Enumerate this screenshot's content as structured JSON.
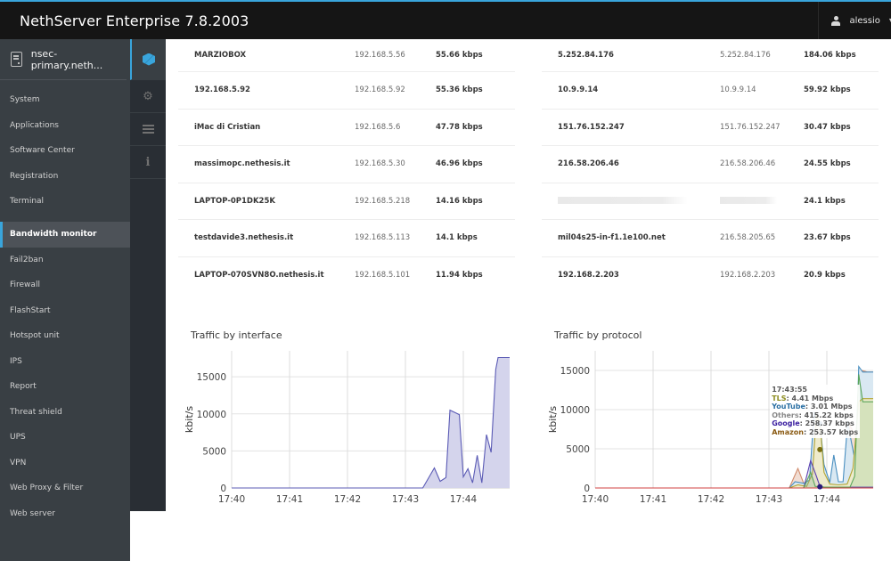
{
  "app": {
    "title": "NethServer Enterprise 7.8.2003",
    "user": "alessio"
  },
  "sidebar": {
    "host": "nsec-primary.neth...",
    "items": [
      {
        "label": "System"
      },
      {
        "label": "Applications"
      },
      {
        "label": "Software Center"
      },
      {
        "label": "Registration"
      },
      {
        "label": "Terminal"
      },
      {
        "label": "Bandwidth monitor",
        "active": true
      },
      {
        "label": "Fail2ban"
      },
      {
        "label": "Firewall"
      },
      {
        "label": "FlashStart"
      },
      {
        "label": "Hotspot unit"
      },
      {
        "label": "IPS"
      },
      {
        "label": "Report"
      },
      {
        "label": "Threat shield"
      },
      {
        "label": "UPS"
      },
      {
        "label": "VPN"
      },
      {
        "label": "Web Proxy & Filter"
      },
      {
        "label": "Web server"
      }
    ]
  },
  "iconbar": {
    "items": [
      {
        "icon": "cube-icon",
        "active": true
      },
      {
        "icon": "gear-icon"
      },
      {
        "icon": "list-icon"
      },
      {
        "icon": "info-icon"
      }
    ]
  },
  "tables": {
    "left": [
      {
        "name": "MARZIOBOX",
        "ip": "192.168.5.56",
        "rate": "55.66 kbps"
      },
      {
        "name": "192.168.5.92",
        "ip": "192.168.5.92",
        "rate": "55.36 kbps"
      },
      {
        "name": "iMac di Cristian",
        "ip": "192.168.5.6",
        "rate": "47.78 kbps"
      },
      {
        "name": "massimopc.nethesis.it",
        "ip": "192.168.5.30",
        "rate": "46.96 kbps"
      },
      {
        "name": "LAPTOP-0P1DK25K",
        "ip": "192.168.5.218",
        "rate": "14.16 kbps"
      },
      {
        "name": "testdavide3.nethesis.it",
        "ip": "192.168.5.113",
        "rate": "14.1 kbps"
      },
      {
        "name": "LAPTOP-070SVN8O.nethesis.it",
        "ip": "192.168.5.101",
        "rate": "11.94 kbps"
      }
    ],
    "right": [
      {
        "name": "5.252.84.176",
        "ip": "5.252.84.176",
        "rate": "184.06 kbps"
      },
      {
        "name": "10.9.9.14",
        "ip": "10.9.9.14",
        "rate": "59.92 kbps"
      },
      {
        "name": "151.76.152.247",
        "ip": "151.76.152.247",
        "rate": "30.47 kbps"
      },
      {
        "name": "216.58.206.46",
        "ip": "216.58.206.46",
        "rate": "24.55 kbps"
      },
      {
        "name": "",
        "ip": "",
        "rate": "24.1 kbps",
        "redacted": true
      },
      {
        "name": "mil04s25-in-f1.1e100.net",
        "ip": "216.58.205.65",
        "rate": "23.67 kbps"
      },
      {
        "name": "192.168.2.203",
        "ip": "192.168.2.203",
        "rate": "20.9 kbps"
      }
    ]
  },
  "tooltip": {
    "time": "17:43:55",
    "entries": [
      {
        "label": "TLS",
        "value": "4.41 Mbps",
        "color": "#8c8c1e"
      },
      {
        "label": "YouTube",
        "value": "3.01 Mbps",
        "color": "#2a6fa3"
      },
      {
        "label": "Others",
        "value": "415.22 kbps",
        "color": "#888888"
      },
      {
        "label": "Google",
        "value": "258.37 kbps",
        "color": "#3b1fa0"
      },
      {
        "label": "Amazon",
        "value": "253.57 kbps",
        "color": "#8a5a12"
      }
    ]
  },
  "chart_data": [
    {
      "type": "area",
      "title": "Traffic by interface",
      "xlabel": "",
      "ylabel": "kbit/s",
      "x_ticks": [
        "17:40",
        "17:41",
        "17:42",
        "17:43",
        "17:44"
      ],
      "xlim_minutes": [
        0,
        4.8
      ],
      "ylim": [
        0,
        18500
      ],
      "y_ticks": [
        0,
        5000,
        10000,
        15000
      ],
      "grid": true,
      "color": "#5b5bb5",
      "fill": "#d4d4ec",
      "series": [
        {
          "name": "interface",
          "x": [
            0,
            3.3,
            3.5,
            3.6,
            3.7,
            3.77,
            3.93,
            4.0,
            4.08,
            4.16,
            4.24,
            4.32,
            4.4,
            4.48,
            4.56,
            4.6,
            4.67,
            4.8
          ],
          "y": [
            0,
            0,
            2700,
            900,
            1400,
            10500,
            9900,
            1500,
            2600,
            700,
            4400,
            700,
            7200,
            4800,
            16000,
            17600,
            17600,
            17600
          ]
        }
      ]
    },
    {
      "type": "area",
      "title": "Traffic by protocol",
      "xlabel": "",
      "ylabel": "kbit/s",
      "x_ticks": [
        "17:40",
        "17:41",
        "17:42",
        "17:43",
        "17:44"
      ],
      "xlim_minutes": [
        0,
        4.8
      ],
      "ylim": [
        0,
        17500
      ],
      "y_ticks": [
        0,
        5000,
        10000,
        15000
      ],
      "grid": true,
      "series": [
        {
          "name": "Others",
          "color": "#d08a6a",
          "fill": "#f1ddd3",
          "x": [
            0,
            3.35,
            3.5,
            3.6,
            3.7,
            3.8,
            3.9,
            4.0,
            4.1,
            4.3,
            4.4,
            4.5,
            4.6,
            4.7,
            4.8
          ],
          "y": [
            0,
            0,
            2500,
            600,
            300,
            1200,
            800,
            500,
            300,
            300,
            8000,
            6500,
            15000,
            14800,
            14800
          ]
        },
        {
          "name": "YouTube",
          "color": "#4a8fc0",
          "fill": "#d9e8f2",
          "x": [
            0,
            3.35,
            3.45,
            3.6,
            3.7,
            3.78,
            3.88,
            3.95,
            4.05,
            4.12,
            4.2,
            4.28,
            4.36,
            4.42,
            4.5,
            4.55,
            4.62,
            4.8
          ],
          "y": [
            0,
            0,
            800,
            600,
            1000,
            9600,
            8400,
            3000,
            700,
            4200,
            800,
            800,
            8500,
            6000,
            3000,
            15500,
            14800,
            14800
          ]
        },
        {
          "name": "TLS",
          "color": "#b3a532",
          "fill": "#eeebcc",
          "x": [
            0,
            3.35,
            3.5,
            3.65,
            3.75,
            3.82,
            3.88,
            3.95,
            4.05,
            4.2,
            4.35,
            4.45,
            4.55,
            4.62,
            4.8
          ],
          "y": [
            0,
            0,
            400,
            200,
            1800,
            9300,
            8400,
            2000,
            500,
            400,
            500,
            2500,
            11000,
            11400,
            11400
          ]
        },
        {
          "name": "Google",
          "color": "#5a3fb0",
          "fill": "rgba(90,63,176,0.08)",
          "x": [
            0,
            3.6,
            3.72,
            3.82,
            3.88,
            3.95,
            4.8
          ],
          "y": [
            0,
            0,
            3500,
            1500,
            200,
            100,
            100
          ]
        },
        {
          "name": "Amazon",
          "color": "#5aa55a",
          "fill": "rgba(140,200,140,0.25)",
          "x": [
            0,
            3.6,
            3.72,
            3.8,
            3.9,
            4.4,
            4.48,
            4.55,
            4.62,
            4.8
          ],
          "y": [
            0,
            0,
            2000,
            200,
            100,
            100,
            1500,
            14500,
            11000,
            11000
          ]
        },
        {
          "name": "baseline",
          "color": "#d04040",
          "fill": "none",
          "x": [
            0,
            4.8
          ],
          "y": [
            0,
            0
          ]
        }
      ],
      "markers": [
        {
          "series": "YouTube",
          "x": 3.88,
          "y": 8200,
          "color": "#1f5a8a"
        },
        {
          "series": "TLS",
          "x": 3.88,
          "y": 4900,
          "color": "#7a6f10"
        },
        {
          "series": "Google",
          "x": 3.88,
          "y": 150,
          "color": "#2a1a7a"
        }
      ]
    }
  ]
}
